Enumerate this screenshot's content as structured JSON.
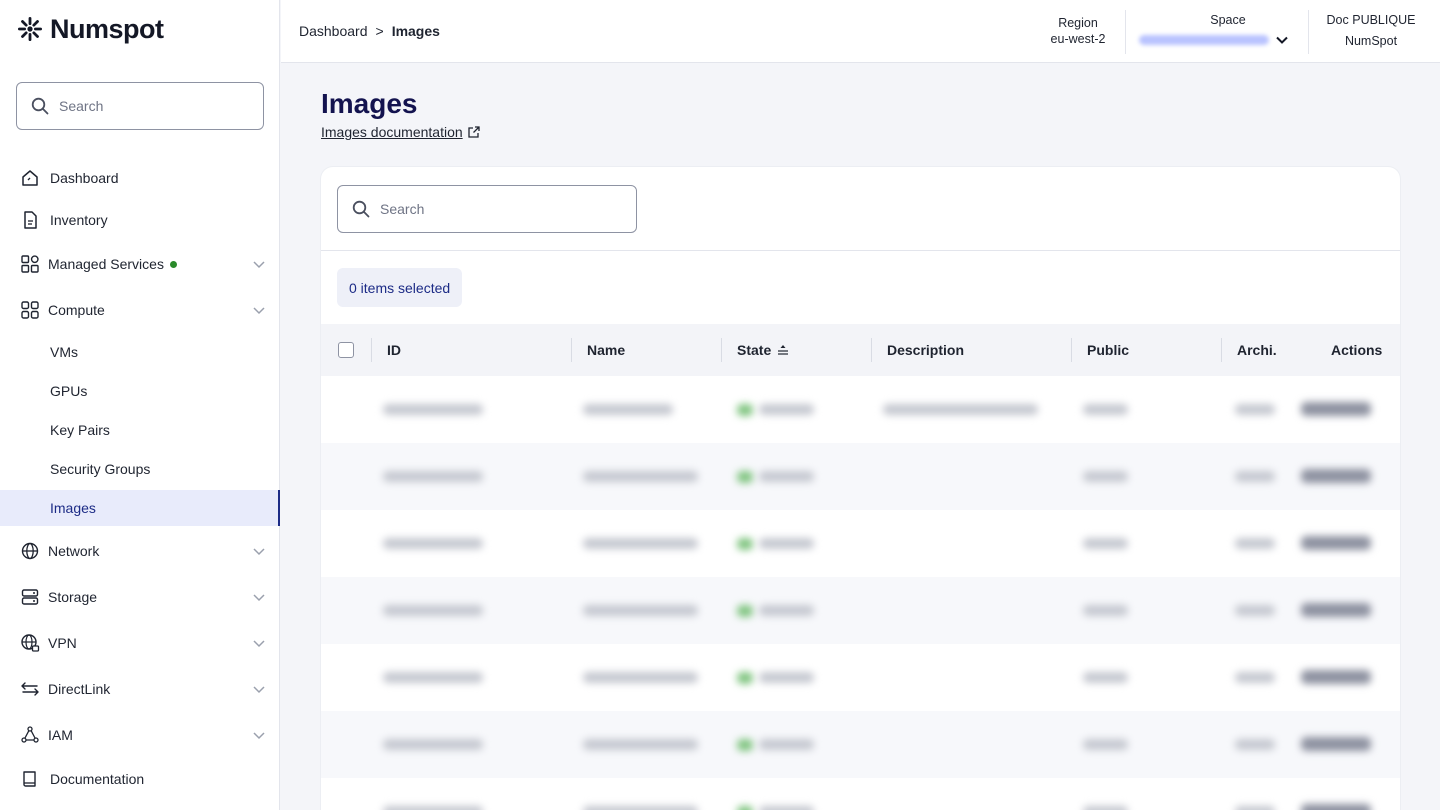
{
  "brand": {
    "name": "Numspot"
  },
  "sidebar": {
    "search_placeholder": "Search",
    "items": [
      {
        "label": "Dashboard"
      },
      {
        "label": "Inventory"
      },
      {
        "label": "Managed Services"
      },
      {
        "label": "Compute"
      },
      {
        "label": "Network"
      },
      {
        "label": "Storage"
      },
      {
        "label": "VPN"
      },
      {
        "label": "DirectLink"
      },
      {
        "label": "IAM"
      },
      {
        "label": "Documentation"
      }
    ],
    "compute_sub": [
      {
        "label": "VMs"
      },
      {
        "label": "GPUs"
      },
      {
        "label": "Key Pairs"
      },
      {
        "label": "Security Groups"
      },
      {
        "label": "Images",
        "active": true
      }
    ]
  },
  "header": {
    "breadcrumb": {
      "root": "Dashboard",
      "separator": ">",
      "current": "Images"
    },
    "region": {
      "label": "Region",
      "value": "eu-west-2"
    },
    "space": {
      "label": "Space"
    },
    "org": {
      "label": "Doc PUBLIQUE",
      "value": "NumSpot"
    }
  },
  "main": {
    "title": "Images",
    "doc_link": "Images documentation",
    "table_search_placeholder": "Search",
    "selected_label": "0 items selected",
    "columns": [
      "ID",
      "Name",
      "State",
      "Description",
      "Public",
      "Archi.",
      "Actions"
    ]
  },
  "colors": {
    "accent": "#1c2b86",
    "title": "#13134f",
    "status_dot": "#2a8a2a"
  }
}
